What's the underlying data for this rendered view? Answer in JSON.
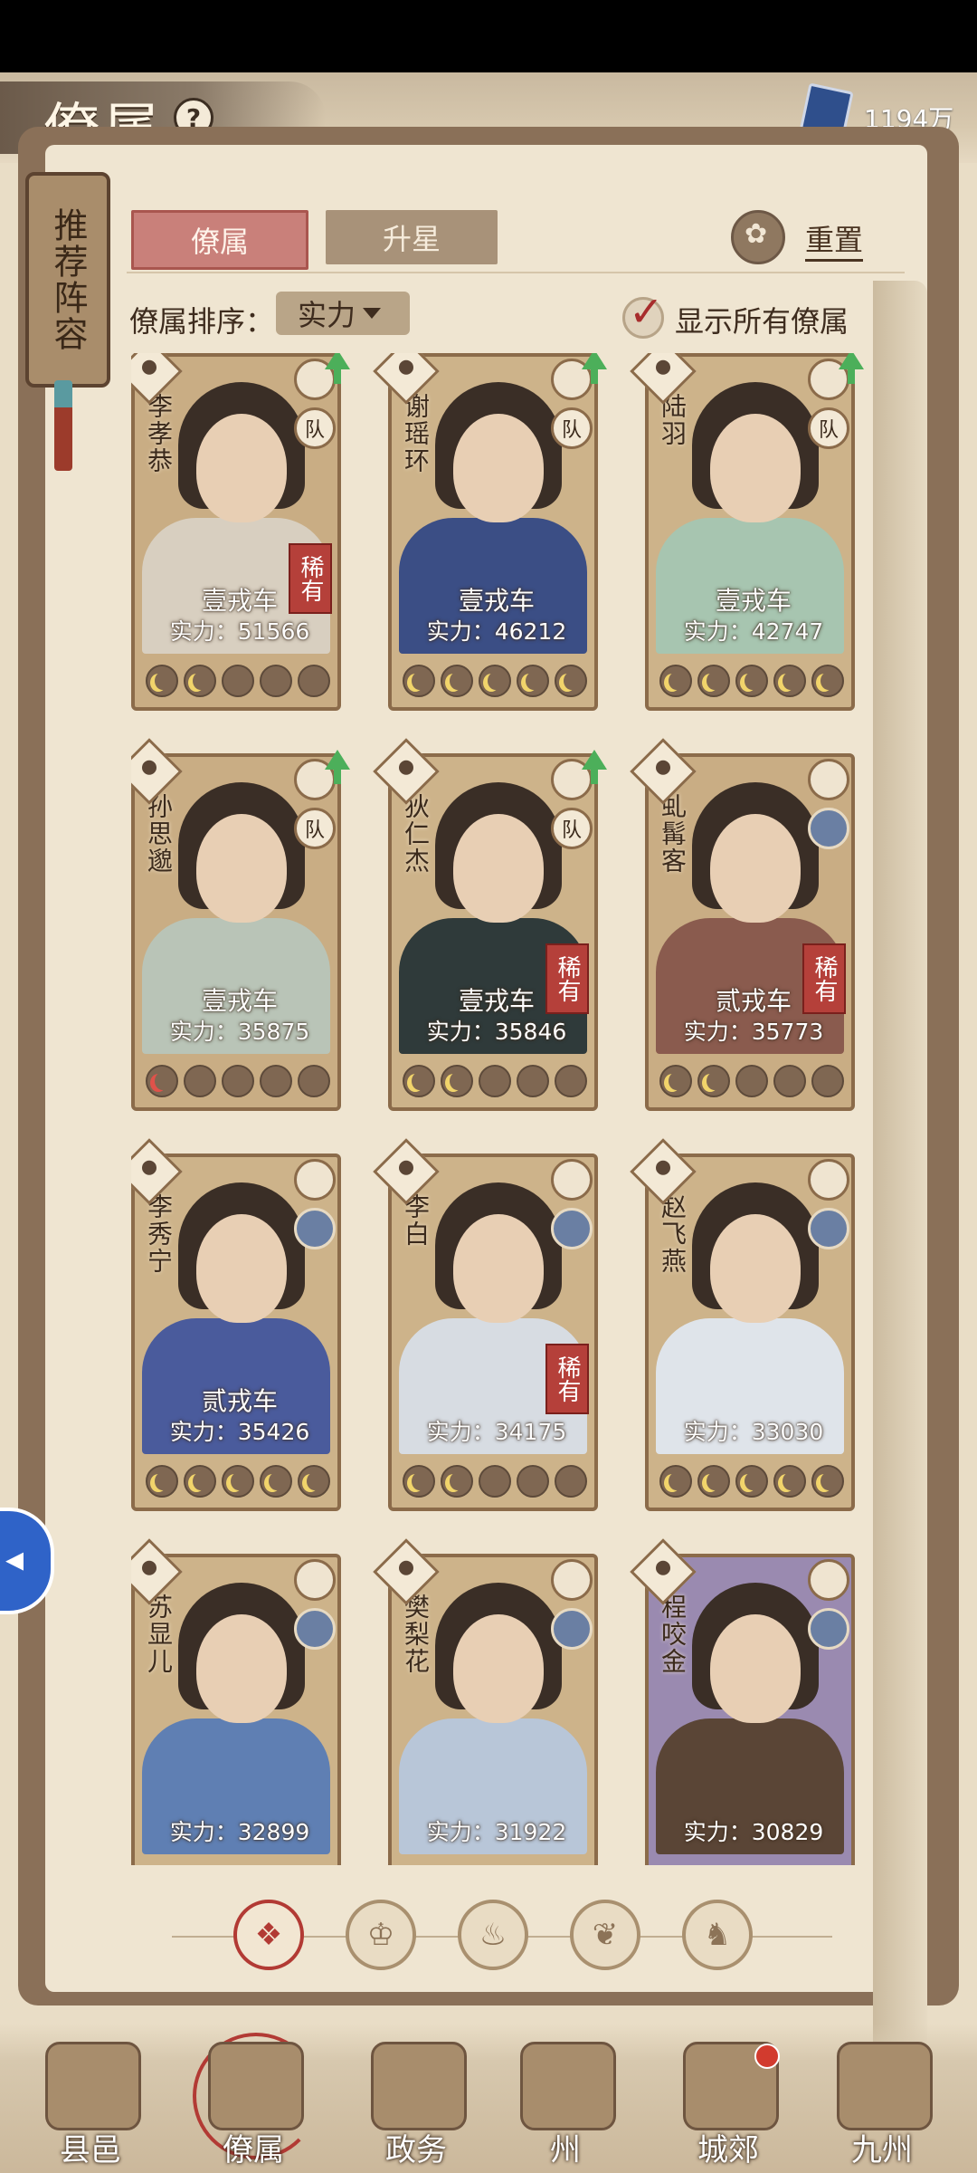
{
  "header": {
    "title": "僚属",
    "help_icon": "question-icon",
    "currency_icon": "blue-book-icon",
    "currency_value": "1194万"
  },
  "recommend_tag": {
    "label": "推荐阵容"
  },
  "tabs": [
    {
      "label": "僚属",
      "active": true
    },
    {
      "label": "升星",
      "active": false
    }
  ],
  "reset": {
    "icon": "reset-flower-icon",
    "label": "重置"
  },
  "sort": {
    "label": "僚属排序：",
    "value": "实力"
  },
  "show_all": {
    "checked": true,
    "label": "显示所有僚属"
  },
  "team_badge_label": "队",
  "rare_label": "稀有",
  "cards": [
    {
      "name": "李孝恭",
      "grade": "壹戎车",
      "power": "实力：51566",
      "stars_lit": 2,
      "rare": true,
      "team": true,
      "upgrade": true,
      "robe": "#d8cfc0",
      "bg": "#c9ad84"
    },
    {
      "name": "谢瑶环",
      "grade": "壹戎车",
      "power": "实力：46212",
      "stars_lit": 5,
      "rare": false,
      "team": true,
      "upgrade": true,
      "robe": "#3b4e85",
      "bg": "#cdb38a"
    },
    {
      "name": "陆羽",
      "grade": "壹戎车",
      "power": "实力：42747",
      "stars_lit": 5,
      "rare": false,
      "team": true,
      "upgrade": true,
      "robe": "#a7c5b0",
      "bg": "#cdb38a"
    },
    {
      "name": "孙思邈",
      "grade": "壹戎车",
      "power": "实力：35875",
      "stars_lit": 1,
      "rare": false,
      "team": true,
      "upgrade": true,
      "robe": "#b9c4b7",
      "bg": "#c9ad84",
      "red_star": true
    },
    {
      "name": "狄仁杰",
      "grade": "壹戎车",
      "power": "实力：35846",
      "stars_lit": 2,
      "rare": true,
      "team": true,
      "upgrade": true,
      "robe": "#2f3a3a",
      "bg": "#cdb38a"
    },
    {
      "name": "虬髯客",
      "grade": "贰戎车",
      "power": "实力：35773",
      "stars_lit": 2,
      "rare": true,
      "team": false,
      "upgrade": false,
      "robe": "#8a5b4e",
      "bg": "#c9ad84"
    },
    {
      "name": "李秀宁",
      "grade": "贰戎车",
      "power": "实力：35426",
      "stars_lit": 5,
      "rare": false,
      "team": false,
      "upgrade": false,
      "robe": "#4a5b9c",
      "bg": "#cdb38a"
    },
    {
      "name": "李白",
      "grade": "",
      "power": "实力：34175",
      "stars_lit": 2,
      "rare": true,
      "team": false,
      "upgrade": false,
      "robe": "#d7dce2",
      "bg": "#cdb38a"
    },
    {
      "name": "赵飞燕",
      "grade": "",
      "power": "实力：33030",
      "stars_lit": 5,
      "rare": false,
      "team": false,
      "upgrade": false,
      "robe": "#dfe4ea",
      "bg": "#cdb38a"
    },
    {
      "name": "苏显儿",
      "grade": "",
      "power": "实力：32899",
      "stars_lit": 0,
      "rare": false,
      "team": false,
      "upgrade": false,
      "robe": "#5f7fb3",
      "bg": "#cdb38a"
    },
    {
      "name": "樊梨花",
      "grade": "",
      "power": "实力：31922",
      "stars_lit": 0,
      "rare": false,
      "team": false,
      "upgrade": false,
      "robe": "#b8c6d8",
      "bg": "#cdb38a"
    },
    {
      "name": "程咬金",
      "grade": "",
      "power": "实力：30829",
      "stars_lit": 0,
      "rare": false,
      "team": false,
      "upgrade": false,
      "robe": "#5a4536",
      "bg": "#9a8ab0"
    }
  ],
  "filters": [
    {
      "icon": "all-diamond-icon",
      "glyph": "❖",
      "active": true
    },
    {
      "icon": "helmet-icon",
      "glyph": "♔",
      "active": false
    },
    {
      "icon": "gourd-icon",
      "glyph": "♨",
      "active": false
    },
    {
      "icon": "fan-icon",
      "glyph": "❦",
      "active": false
    },
    {
      "icon": "horse-icon",
      "glyph": "♞",
      "active": false
    }
  ],
  "nav": [
    {
      "label": "县邑",
      "icon": "county-gate-icon",
      "active": false
    },
    {
      "label": "僚属",
      "icon": "subordinates-icon",
      "active": true
    },
    {
      "label": "政务",
      "icon": "government-affairs-icon",
      "active": false
    },
    {
      "label": "州",
      "icon": "prefecture-icon",
      "active": false
    },
    {
      "label": "城郊",
      "icon": "suburbs-icon",
      "active": false,
      "notify": true
    },
    {
      "label": "九州",
      "icon": "nine-provinces-map-icon",
      "active": false
    }
  ]
}
